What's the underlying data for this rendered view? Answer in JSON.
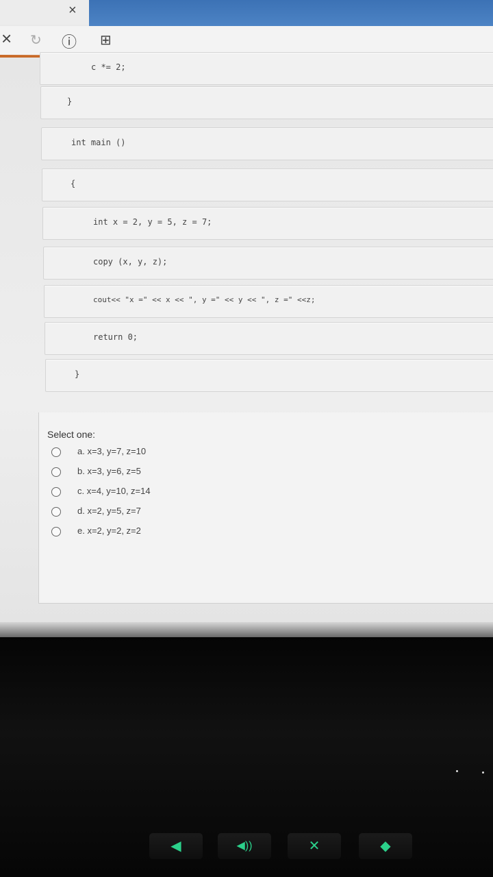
{
  "browser": {
    "tab_close": "×",
    "toolbar_icons": [
      "close-icon",
      "reload-icon",
      "info-icon",
      "new-page-icon"
    ],
    "toolbar_glyphs": [
      "×",
      "↻",
      "ⓘ",
      "⊞"
    ]
  },
  "code": {
    "lines": [
      "c *= 2;",
      "}",
      "int main ()",
      "{",
      "int x = 2, y = 5, z = 7;",
      "copy (x, y, z);",
      "cout<< \"x =\" << x << \", y =\" << y << \", z =\" <<z;",
      "return 0;",
      "}"
    ]
  },
  "question": {
    "prompt": "Select one:",
    "options": [
      "a. x=3, y=7, z=10",
      "b. x=3, y=6, z=5",
      "c. x=4, y=10, z=14",
      "d. x=2, y=5, z=7",
      "e. x=2, y=2, z=2"
    ]
  },
  "keyboard": {
    "keys": [
      "volume-down-icon",
      "volume-up-icon",
      "mic-mute-icon",
      "function-icon"
    ],
    "glyphs": [
      "◀",
      "◀))",
      "✕",
      "◆"
    ]
  }
}
